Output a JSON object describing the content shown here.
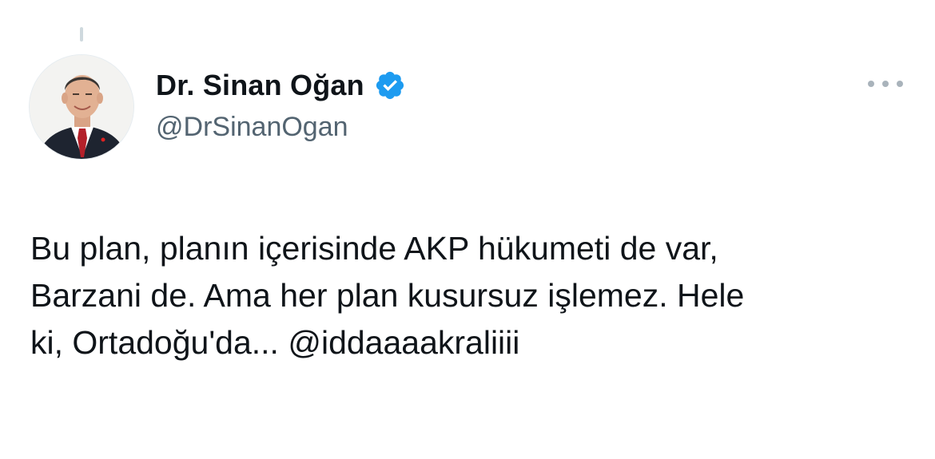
{
  "tweet": {
    "author": {
      "display_name": "Dr. Sinan Oğan",
      "handle": "@DrSinanOgan",
      "verified": true,
      "verified_badge_color": "#1d9bf0",
      "avatar_icon": "profile-photo"
    },
    "more_icon": "ellipsis-icon",
    "text_lines": [
      "Bu plan, planın içerisinde AKP hükumeti de var,",
      "Barzani de. Ama her plan kusursuz işlemez. Hele",
      "ki, Ortadoğu'da... "
    ],
    "mention": "@iddaaaakraliiii"
  }
}
